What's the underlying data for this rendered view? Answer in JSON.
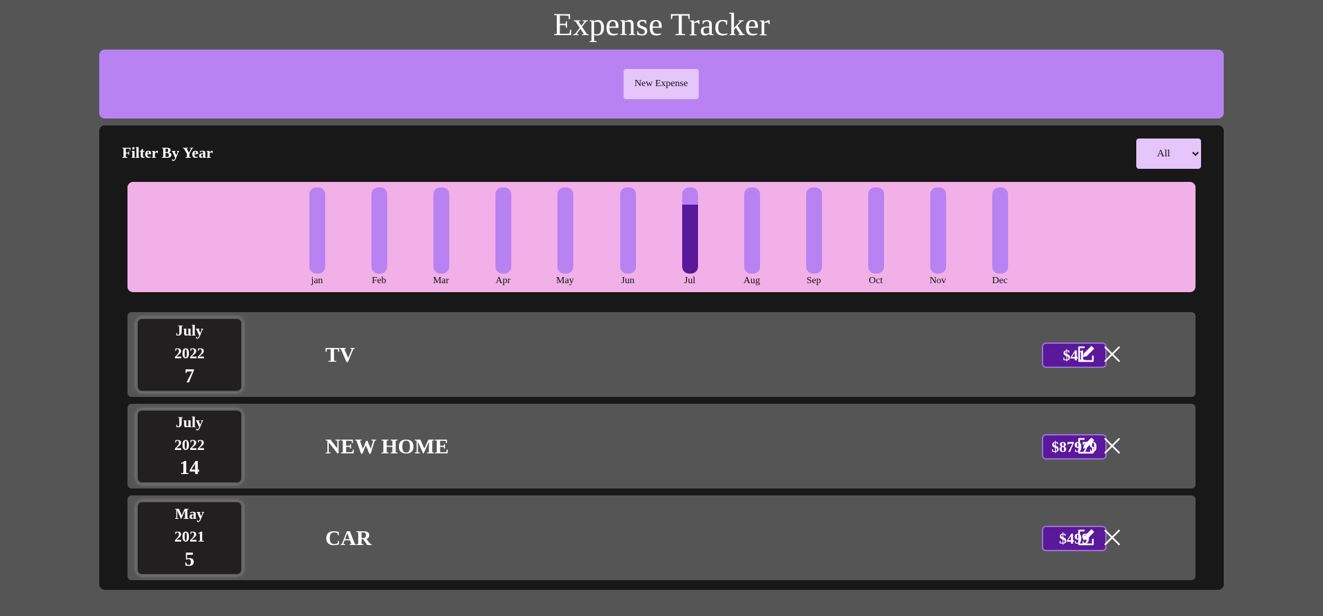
{
  "app": {
    "title": "Expense Tracker"
  },
  "toolbar": {
    "new_expense_label": "New Expense"
  },
  "filter": {
    "label": "Filter By Year",
    "selected": "All",
    "options": [
      "All"
    ]
  },
  "chart_data": {
    "type": "bar",
    "categories": [
      "jan",
      "Feb",
      "Mar",
      "Apr",
      "May",
      "Jun",
      "Jul",
      "Aug",
      "Sep",
      "Oct",
      "Nov",
      "Dec"
    ],
    "values": [
      0,
      0,
      0,
      0,
      0,
      0,
      0.8,
      0,
      0,
      0,
      0,
      0
    ],
    "value_unit": "fraction of bar filled",
    "colors": {
      "track": "#b982f2",
      "fill": "#5a189a",
      "background": "#f1b0e7"
    }
  },
  "expenses": [
    {
      "month": "July",
      "year": "2022",
      "day": "7",
      "title": "TV",
      "amount": "$41"
    },
    {
      "month": "July",
      "year": "2022",
      "day": "14",
      "title": "NEW HOME",
      "amount": "$87979"
    },
    {
      "month": "May",
      "year": "2021",
      "day": "5",
      "title": "CAR",
      "amount": "$499"
    }
  ],
  "colors": {
    "page_bg": "#555555",
    "panel_bg": "#181818",
    "accent": "#b982f2",
    "accent_light": "#e5c5fa",
    "price_bg": "#5a189a"
  },
  "icons": {
    "edit": "edit-icon",
    "delete": "close-icon"
  }
}
